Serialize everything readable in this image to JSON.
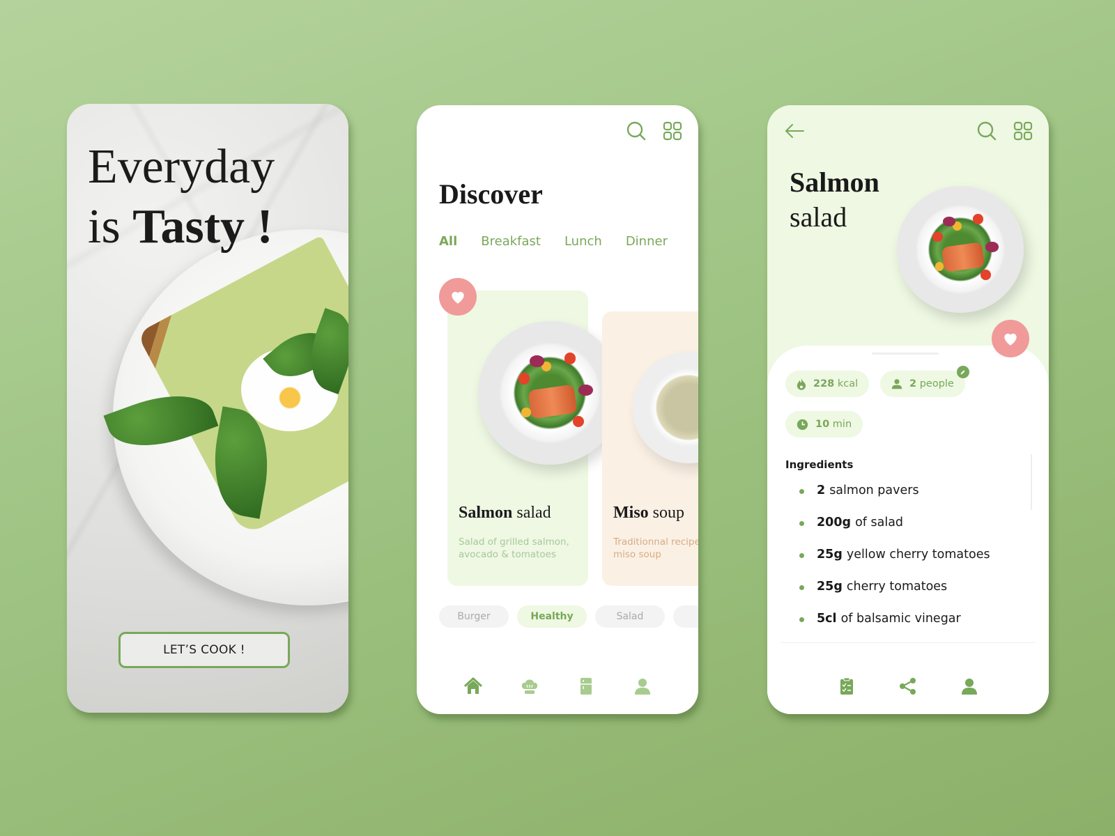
{
  "background_color": "#9fc484",
  "colors": {
    "accent": "#78a85a",
    "light_green": "#eef8e3",
    "peach": "#fbf0e4",
    "heart": "#f19a9a",
    "text": "#1a1a1a"
  },
  "screen1": {
    "headline_line1": "Everyday",
    "headline_is": "is",
    "headline_bold": "Tasty",
    "headline_bang": "!",
    "cta_label": "LET’S COOK !"
  },
  "screen2": {
    "title": "Discover",
    "top_icons": [
      "search-icon",
      "grid-icon"
    ],
    "tabs": [
      {
        "label": "All",
        "active": true
      },
      {
        "label": "Breakfast",
        "active": false
      },
      {
        "label": "Lunch",
        "active": false
      },
      {
        "label": "Dinner",
        "active": false
      }
    ],
    "cards": [
      {
        "title_bold": "Salmon",
        "title_rest": "salad",
        "description_line1": "Salad of grilled salmon,",
        "description_line2": "avocado & tomatoes",
        "favorite": true
      },
      {
        "title_bold": "Miso",
        "title_rest": "soup",
        "description_line1": "Traditionnal recipe of",
        "description_line2": "miso soup",
        "favorite": false
      }
    ],
    "chips": [
      {
        "label": "Burger",
        "active": false
      },
      {
        "label": "Healthy",
        "active": true
      },
      {
        "label": "Salad",
        "active": false
      },
      {
        "label": "",
        "active": false
      }
    ],
    "bottom_nav": [
      "home-icon",
      "chef-hat-icon",
      "fridge-icon",
      "user-icon"
    ]
  },
  "screen3": {
    "title_bold": "Salmon",
    "title_rest": "salad",
    "stats": {
      "kcal_value": "228",
      "kcal_unit": "kcal",
      "people_value": "2",
      "people_unit": "people",
      "time_value": "10",
      "time_unit": "min"
    },
    "ingredients_title": "Ingredients",
    "ingredients": [
      {
        "qty": "2",
        "name": "salmon pavers"
      },
      {
        "qty": "200g",
        "name": "of salad"
      },
      {
        "qty": "25g",
        "name": "yellow cherry tomatoes"
      },
      {
        "qty": "25g",
        "name": "cherry tomatoes"
      },
      {
        "qty": "5cl",
        "name": "of balsamic vinegar"
      }
    ],
    "bottom_nav": [
      "checklist-icon",
      "share-icon",
      "user-icon"
    ]
  }
}
